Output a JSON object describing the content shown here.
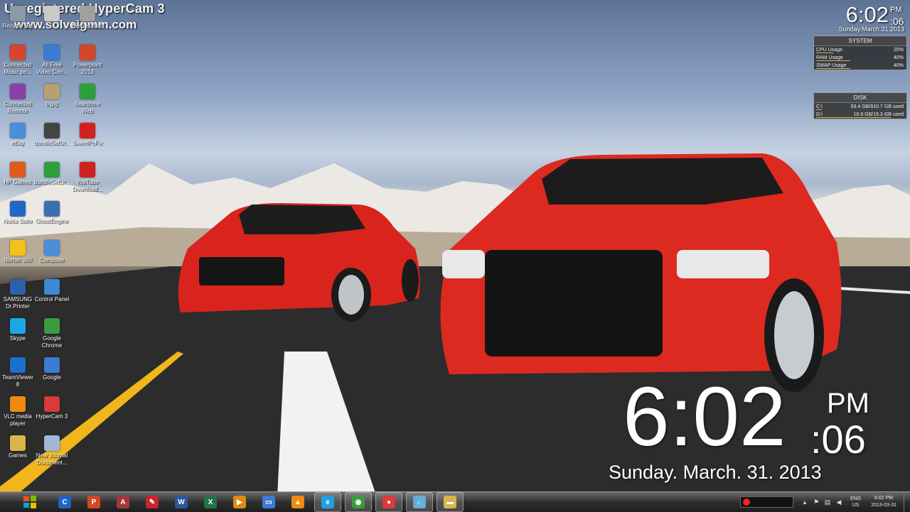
{
  "watermark": {
    "line1": "Unregistered HyperCam 3",
    "line2": "www.solveigmm.com"
  },
  "desktop_icons": [
    {
      "label": "Recycle Bin",
      "icon": "recycle-bin-icon",
      "color": "#8a9aa8"
    },
    {
      "label": "",
      "icon": "file-icon",
      "color": "#c9c9c9"
    },
    {
      "label": "Nero Instant",
      "icon": "nero-icon",
      "color": "#a0a0a0"
    },
    {
      "label": "Connected Music po...",
      "icon": "music-icon",
      "color": "#d7452e"
    },
    {
      "label": "All Free Video Con...",
      "icon": "video-converter-icon",
      "color": "#3a7bd5"
    },
    {
      "label": "Powerpoint 2013",
      "icon": "powerpoint-icon",
      "color": "#d24726"
    },
    {
      "label": "Connected Remote",
      "icon": "remote-icon",
      "color": "#8b3fa8"
    },
    {
      "label": "b.jpg",
      "icon": "image-file-icon",
      "color": "#b8a070"
    },
    {
      "label": "Searchme Web",
      "icon": "installer-icon",
      "color": "#2e9e3a"
    },
    {
      "label": "eBay",
      "icon": "ebay-icon",
      "color": "#4a8fd8"
    },
    {
      "label": "bundleSetUr...",
      "icon": "bundle-icon",
      "color": "#444444"
    },
    {
      "label": "SweetPcFix",
      "icon": "sweetpcfix-icon",
      "color": "#d32020"
    },
    {
      "label": "HP Games",
      "icon": "hp-games-icon",
      "color": "#e05a1c"
    },
    {
      "label": "bundleSetUr...",
      "icon": "installer-icon",
      "color": "#2e9e3a"
    },
    {
      "label": "YouTube Download...",
      "icon": "youtube-icon",
      "color": "#cc2222"
    },
    {
      "label": "Nokia Suite",
      "icon": "nokia-icon",
      "color": "#2466c7"
    },
    {
      "label": "GhostEngine",
      "icon": "ghost-engine-icon",
      "color": "#3a6fb0"
    },
    {
      "label": "",
      "icon": "blank-icon",
      "color": "#000000"
    },
    {
      "label": "Norton 360",
      "icon": "norton-icon",
      "color": "#f2c21b"
    },
    {
      "label": "Computer",
      "icon": "computer-icon",
      "color": "#4a8fd8"
    },
    {
      "label": "",
      "icon": "blank-icon",
      "color": "#000000"
    },
    {
      "label": "SAMSUNG Dr.Printer",
      "icon": "printer-icon",
      "color": "#3160a8"
    },
    {
      "label": "Control Panel",
      "icon": "control-panel-icon",
      "color": "#3a8ad8"
    },
    {
      "label": "",
      "icon": "blank-icon",
      "color": "#000000"
    },
    {
      "label": "Skype",
      "icon": "skype-icon",
      "color": "#19a9e5"
    },
    {
      "label": "Google Chrome",
      "icon": "chrome-icon",
      "color": "#3c9b3c"
    },
    {
      "label": "",
      "icon": "blank-icon",
      "color": "#000000"
    },
    {
      "label": "TeamViewer 8",
      "icon": "teamviewer-icon",
      "color": "#1b6fcf"
    },
    {
      "label": "Google",
      "icon": "google-icon",
      "color": "#3a7bd5"
    },
    {
      "label": "",
      "icon": "blank-icon",
      "color": "#000000"
    },
    {
      "label": "VLC media player",
      "icon": "vlc-icon",
      "color": "#f08a12"
    },
    {
      "label": "HyperCam 3",
      "icon": "hypercam-icon",
      "color": "#d93a3a"
    },
    {
      "label": "",
      "icon": "blank-icon",
      "color": "#000000"
    },
    {
      "label": "Games",
      "icon": "folder-icon",
      "color": "#d9b44a"
    },
    {
      "label": "New Journal Document...",
      "icon": "journal-icon",
      "color": "#9fb8d6"
    }
  ],
  "small_clock": {
    "time": "6:02",
    "ampm": "PM",
    "seconds": ":06",
    "date": "Sunday.March.31.2013"
  },
  "system_gadget": {
    "title": "SYSTEM",
    "rows": [
      {
        "label": "CPU Usage",
        "value": "20%",
        "level": 0.2
      },
      {
        "label": "RAM Usage",
        "value": "40%",
        "level": 0.4
      },
      {
        "label": "SWAP Usage",
        "value": "40%",
        "level": 0.4
      }
    ]
  },
  "disk_gadget": {
    "title": "DISK",
    "rows": [
      {
        "label": "C:\\",
        "value": "59.4 GB/910.7 GB used",
        "level": 0.065
      },
      {
        "label": "D:\\",
        "value": "16.9 GB/19.3 GB used",
        "level": 0.876
      }
    ]
  },
  "big_clock": {
    "time": "6:02",
    "ampm": "PM",
    "seconds": ":06",
    "date": "Sunday. March. 31. 2013"
  },
  "taskbar": {
    "apps": [
      {
        "name": "taskbar-cortana-c",
        "icon": "c-logo-icon",
        "color": "#1e63c5",
        "glyph": "C"
      },
      {
        "name": "taskbar-powerpoint",
        "icon": "powerpoint-icon",
        "color": "#d24726",
        "glyph": "P"
      },
      {
        "name": "taskbar-access",
        "icon": "access-icon",
        "color": "#a4373a",
        "glyph": "A"
      },
      {
        "name": "taskbar-pdf",
        "icon": "pdf-icon",
        "color": "#c8262a",
        "glyph": "✎"
      },
      {
        "name": "taskbar-word",
        "icon": "word-icon",
        "color": "#2b579a",
        "glyph": "W"
      },
      {
        "name": "taskbar-excel",
        "icon": "excel-icon",
        "color": "#217346",
        "glyph": "X"
      },
      {
        "name": "taskbar-media",
        "icon": "media-player-icon",
        "color": "#e08a12",
        "glyph": "▶"
      },
      {
        "name": "taskbar-window",
        "icon": "window-icon",
        "color": "#3a7bd5",
        "glyph": "▭"
      },
      {
        "name": "taskbar-vlc",
        "icon": "vlc-icon",
        "color": "#f08a12",
        "glyph": "▲"
      },
      {
        "name": "taskbar-ie",
        "icon": "internet-explorer-icon",
        "color": "#1ea0e0",
        "glyph": "e"
      },
      {
        "name": "taskbar-chrome",
        "icon": "chrome-icon",
        "color": "#3c9b3c",
        "glyph": "◉"
      },
      {
        "name": "taskbar-hypercam",
        "icon": "hypercam-icon",
        "color": "#d93a3a",
        "glyph": "●"
      },
      {
        "name": "taskbar-drop",
        "icon": "water-drop-icon",
        "color": "#6fa8d8",
        "glyph": "💧"
      },
      {
        "name": "taskbar-explorer",
        "icon": "folder-icon",
        "color": "#d9b44a",
        "glyph": "▬"
      }
    ],
    "lang_top": "ENG",
    "lang_bottom": "US",
    "clock_time": "6:02 PM",
    "clock_date": "2013-03-31"
  }
}
